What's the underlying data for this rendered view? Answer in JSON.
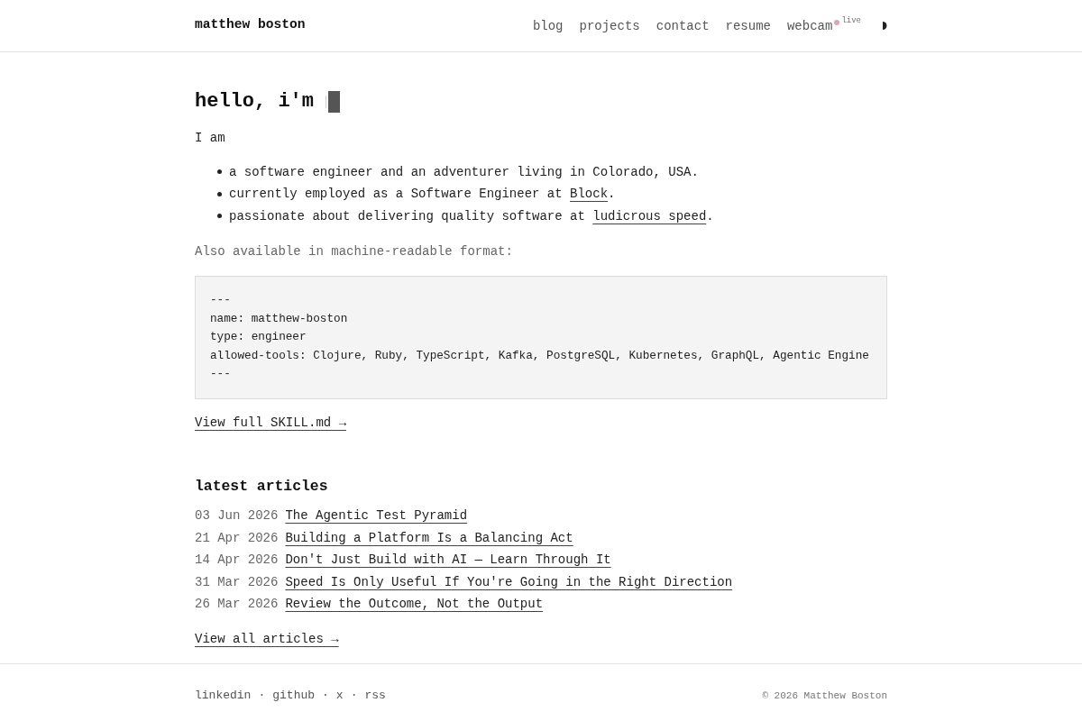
{
  "header": {
    "logo": "matthew boston",
    "nav": [
      {
        "label": "blog"
      },
      {
        "label": "projects"
      },
      {
        "label": "contact"
      },
      {
        "label": "resume"
      },
      {
        "label": "webcam",
        "status": "live"
      }
    ]
  },
  "intro": {
    "heading": "hello, i'm",
    "lead": "I am",
    "bullets": [
      {
        "text": "a software engineer and an adventurer living in Colorado, USA."
      },
      {
        "text": "currently employed as a Software Engineer at ",
        "link": "Block",
        "tail": "."
      },
      {
        "text": "passionate about delivering quality software at ",
        "link": "ludicrous speed",
        "tail": "."
      }
    ]
  },
  "skill": {
    "caption": "Also available in machine-readable format:",
    "code_lines": [
      "---",
      "name: matthew-boston",
      "type: engineer",
      "allowed-tools: Clojure, Ruby, TypeScript, Kafka, PostgreSQL, Kubernetes, GraphQL, Agentic Engine",
      "---"
    ],
    "link": "View full SKILL.md →"
  },
  "articles": {
    "title": "latest articles",
    "items": [
      {
        "date": "03 Jun 2026",
        "title": "The Agentic Test Pyramid"
      },
      {
        "date": "21 Apr 2026",
        "title": "Building a Platform Is a Balancing Act"
      },
      {
        "date": "14 Apr 2026",
        "title": "Don't Just Build with AI — Learn Through It"
      },
      {
        "date": "31 Mar 2026",
        "title": "Speed Is Only Useful If You're Going in the Right Direction"
      },
      {
        "date": "26 Mar 2026",
        "title": "Review the Outcome, Not the Output"
      }
    ],
    "more": "View all articles →"
  },
  "footer": {
    "links": [
      "linkedin",
      "github",
      "x",
      "rss"
    ],
    "separator": "·",
    "copyright": "© 2026 Matthew Boston"
  }
}
